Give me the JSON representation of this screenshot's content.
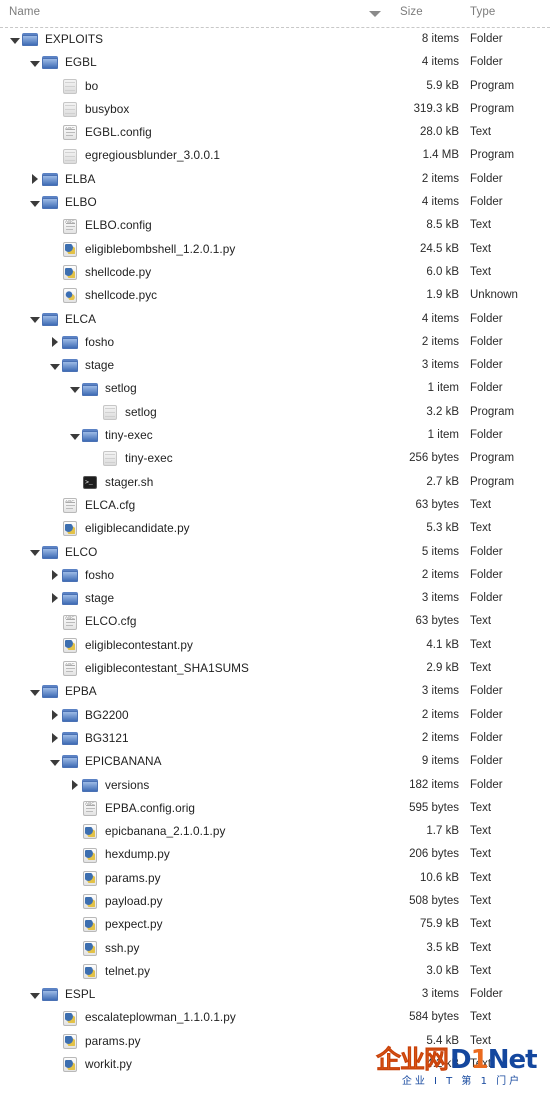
{
  "header": {
    "name_label": "Name",
    "size_label": "Size",
    "type_label": "Type",
    "sort_icon": "sort-descending-icon"
  },
  "colors": {
    "folder_blue": "#3f6cb5",
    "text_gray": "#2b2b2b",
    "header_gray": "#7c7c7c",
    "watermark_orange": "#ea6a1e",
    "watermark_blue": "#14479e"
  },
  "rows": [
    {
      "depth": 0,
      "twisty": "open",
      "icon": "folder",
      "name": "EXPLOITS",
      "size": "8 items",
      "type": "Folder"
    },
    {
      "depth": 1,
      "twisty": "open",
      "icon": "folder",
      "name": "EGBL",
      "size": "4 items",
      "type": "Folder"
    },
    {
      "depth": 2,
      "twisty": "none",
      "icon": "prog",
      "name": "bo",
      "size": "5.9 kB",
      "type": "Program"
    },
    {
      "depth": 2,
      "twisty": "none",
      "icon": "prog",
      "name": "busybox",
      "size": "319.3 kB",
      "type": "Program"
    },
    {
      "depth": 2,
      "twisty": "none",
      "icon": "doc",
      "name": "EGBL.config",
      "size": "28.0 kB",
      "type": "Text"
    },
    {
      "depth": 2,
      "twisty": "none",
      "icon": "prog",
      "name": "egregiousblunder_3.0.0.1",
      "size": "1.4 MB",
      "type": "Program"
    },
    {
      "depth": 1,
      "twisty": "closed",
      "icon": "folder",
      "name": "ELBA",
      "size": "2 items",
      "type": "Folder"
    },
    {
      "depth": 1,
      "twisty": "open",
      "icon": "folder",
      "name": "ELBO",
      "size": "4 items",
      "type": "Folder"
    },
    {
      "depth": 2,
      "twisty": "none",
      "icon": "doc",
      "name": "ELBO.config",
      "size": "8.5 kB",
      "type": "Text"
    },
    {
      "depth": 2,
      "twisty": "none",
      "icon": "py",
      "name": "eligiblebombshell_1.2.0.1.py",
      "size": "24.5 kB",
      "type": "Text"
    },
    {
      "depth": 2,
      "twisty": "none",
      "icon": "py",
      "name": "shellcode.py",
      "size": "6.0 kB",
      "type": "Text"
    },
    {
      "depth": 2,
      "twisty": "none",
      "icon": "unknown",
      "name": "shellcode.pyc",
      "size": "1.9 kB",
      "type": "Unknown"
    },
    {
      "depth": 1,
      "twisty": "open",
      "icon": "folder",
      "name": "ELCA",
      "size": "4 items",
      "type": "Folder"
    },
    {
      "depth": 2,
      "twisty": "closed",
      "icon": "folder",
      "name": "fosho",
      "size": "2 items",
      "type": "Folder"
    },
    {
      "depth": 2,
      "twisty": "open",
      "icon": "folder",
      "name": "stage",
      "size": "3 items",
      "type": "Folder"
    },
    {
      "depth": 3,
      "twisty": "open",
      "icon": "folder",
      "name": "setlog",
      "size": "1 item",
      "type": "Folder"
    },
    {
      "depth": 4,
      "twisty": "none",
      "icon": "prog",
      "name": "setlog",
      "size": "3.2 kB",
      "type": "Program"
    },
    {
      "depth": 3,
      "twisty": "open",
      "icon": "folder",
      "name": "tiny-exec",
      "size": "1 item",
      "type": "Folder"
    },
    {
      "depth": 4,
      "twisty": "none",
      "icon": "prog",
      "name": "tiny-exec",
      "size": "256 bytes",
      "type": "Program"
    },
    {
      "depth": 3,
      "twisty": "none",
      "icon": "sh",
      "name": "stager.sh",
      "size": "2.7 kB",
      "type": "Program"
    },
    {
      "depth": 2,
      "twisty": "none",
      "icon": "doc",
      "name": "ELCA.cfg",
      "size": "63 bytes",
      "type": "Text"
    },
    {
      "depth": 2,
      "twisty": "none",
      "icon": "py",
      "name": "eligiblecandidate.py",
      "size": "5.3 kB",
      "type": "Text"
    },
    {
      "depth": 1,
      "twisty": "open",
      "icon": "folder",
      "name": "ELCO",
      "size": "5 items",
      "type": "Folder"
    },
    {
      "depth": 2,
      "twisty": "closed",
      "icon": "folder",
      "name": "fosho",
      "size": "2 items",
      "type": "Folder"
    },
    {
      "depth": 2,
      "twisty": "closed",
      "icon": "folder",
      "name": "stage",
      "size": "3 items",
      "type": "Folder"
    },
    {
      "depth": 2,
      "twisty": "none",
      "icon": "doc",
      "name": "ELCO.cfg",
      "size": "63 bytes",
      "type": "Text"
    },
    {
      "depth": 2,
      "twisty": "none",
      "icon": "py",
      "name": "eligiblecontestant.py",
      "size": "4.1 kB",
      "type": "Text"
    },
    {
      "depth": 2,
      "twisty": "none",
      "icon": "doc",
      "name": "eligiblecontestant_SHA1SUMS",
      "size": "2.9 kB",
      "type": "Text"
    },
    {
      "depth": 1,
      "twisty": "open",
      "icon": "folder",
      "name": "EPBA",
      "size": "3 items",
      "type": "Folder"
    },
    {
      "depth": 2,
      "twisty": "closed",
      "icon": "folder",
      "name": "BG2200",
      "size": "2 items",
      "type": "Folder"
    },
    {
      "depth": 2,
      "twisty": "closed",
      "icon": "folder",
      "name": "BG3121",
      "size": "2 items",
      "type": "Folder"
    },
    {
      "depth": 2,
      "twisty": "open",
      "icon": "folder",
      "name": "EPICBANANA",
      "size": "9 items",
      "type": "Folder"
    },
    {
      "depth": 3,
      "twisty": "closed",
      "icon": "folder",
      "name": "versions",
      "size": "182 items",
      "type": "Folder"
    },
    {
      "depth": 3,
      "twisty": "none",
      "icon": "doc",
      "name": "EPBA.config.orig",
      "size": "595 bytes",
      "type": "Text"
    },
    {
      "depth": 3,
      "twisty": "none",
      "icon": "py",
      "name": "epicbanana_2.1.0.1.py",
      "size": "1.7 kB",
      "type": "Text"
    },
    {
      "depth": 3,
      "twisty": "none",
      "icon": "py",
      "name": "hexdump.py",
      "size": "206 bytes",
      "type": "Text"
    },
    {
      "depth": 3,
      "twisty": "none",
      "icon": "py",
      "name": "params.py",
      "size": "10.6 kB",
      "type": "Text"
    },
    {
      "depth": 3,
      "twisty": "none",
      "icon": "py",
      "name": "payload.py",
      "size": "508 bytes",
      "type": "Text"
    },
    {
      "depth": 3,
      "twisty": "none",
      "icon": "py",
      "name": "pexpect.py",
      "size": "75.9 kB",
      "type": "Text"
    },
    {
      "depth": 3,
      "twisty": "none",
      "icon": "py",
      "name": "ssh.py",
      "size": "3.5 kB",
      "type": "Text"
    },
    {
      "depth": 3,
      "twisty": "none",
      "icon": "py",
      "name": "telnet.py",
      "size": "3.0 kB",
      "type": "Text"
    },
    {
      "depth": 1,
      "twisty": "open",
      "icon": "folder",
      "name": "ESPL",
      "size": "3 items",
      "type": "Folder"
    },
    {
      "depth": 2,
      "twisty": "none",
      "icon": "py",
      "name": "escalateplowman_1.1.0.1.py",
      "size": "584 bytes",
      "type": "Text"
    },
    {
      "depth": 2,
      "twisty": "none",
      "icon": "py",
      "name": "params.py",
      "size": "5.4 kB",
      "type": "Text"
    },
    {
      "depth": 2,
      "twisty": "none",
      "icon": "py",
      "name": "workit.py",
      "size": "4.2 kB",
      "type": "Text"
    }
  ],
  "watermark": {
    "brand_cn": "企业网",
    "brand_en_d": "D",
    "brand_en_1": "1",
    "brand_en_net": "Net",
    "tagline": "企业 I T 第 1 门户"
  }
}
